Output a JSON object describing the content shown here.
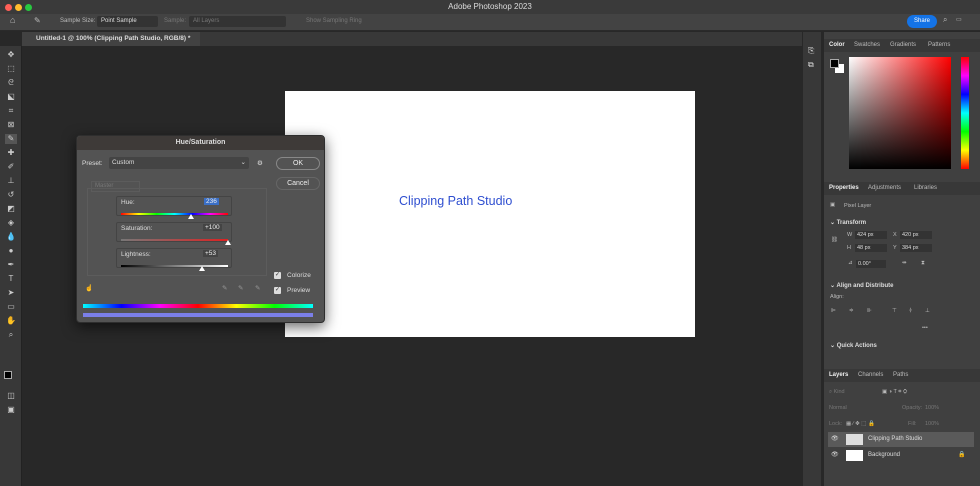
{
  "app": {
    "title": "Adobe Photoshop 2023",
    "share_label": "Share"
  },
  "options_bar": {
    "sample_size_label": "Sample Size:",
    "sample_size_value": "Point Sample",
    "sample_label": "Sample:",
    "sample_value": "All Layers",
    "show_ring_label": "Show Sampling Ring"
  },
  "document": {
    "tab_label": "Untitled-1 @ 100% (Clipping Path Studio, RGB/8) *",
    "text": "Clipping Path Studio",
    "text_color": "#2f4fd0"
  },
  "dialog": {
    "title": "Hue/Saturation",
    "preset_label": "Preset:",
    "preset_value": "Custom",
    "ok_label": "OK",
    "cancel_label": "Cancel",
    "channel": "Master",
    "hue_label": "Hue:",
    "hue_value": "236",
    "saturation_label": "Saturation:",
    "saturation_value": "+100",
    "lightness_label": "Lightness:",
    "lightness_value": "+53",
    "colorize_label": "Colorize",
    "colorize_checked": true,
    "preview_label": "Preview",
    "preview_checked": true
  },
  "color_panel": {
    "tabs": [
      "Color",
      "Swatches",
      "Gradients",
      "Patterns"
    ],
    "active": "Color",
    "picker_hue": "#ff0000"
  },
  "properties_panel": {
    "tabs": [
      "Properties",
      "Adjustments",
      "Libraries"
    ],
    "layer_type": "Pixel Layer",
    "transform_title": "Transform",
    "w": "424 px",
    "x": "420 px",
    "h": "48 px",
    "y": "384 px",
    "w_label": "W",
    "x_label": "X",
    "h_label": "H",
    "y_label": "Y",
    "angle": "0.00°",
    "align_title": "Align and Distribute",
    "align_label": "Align:",
    "more": "•••",
    "quick_actions_title": "Quick Actions"
  },
  "layers_panel": {
    "tabs": [
      "Layers",
      "Channels",
      "Paths"
    ],
    "kind_placeholder": "Kind",
    "blend_mode": "Normal",
    "opacity_label": "Opacity:",
    "opacity_value": "100%",
    "lock_label": "Lock:",
    "fill_label": "Fill:",
    "fill_value": "100%",
    "layers": [
      {
        "name": "Clipping Path Studio",
        "selected": true
      },
      {
        "name": "Background",
        "locked": true
      }
    ]
  }
}
